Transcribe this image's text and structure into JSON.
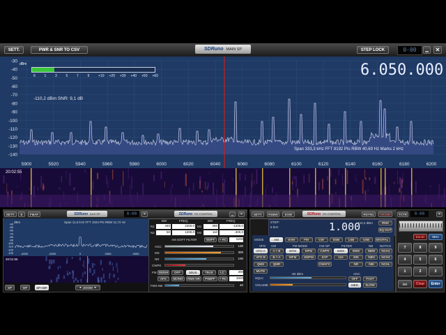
{
  "main": {
    "sett_label": "SETT.",
    "pwr_snr_label": "PWR & SNR TO CSV",
    "logo": "SDRuno",
    "window_title": "MAIN SP",
    "step_lock_label": "STEP LOCK",
    "dbm_unit": "dBm",
    "smeter_ticks": [
      "6",
      "1",
      "3",
      "5",
      "7",
      "9",
      "+10",
      "+20",
      "+30",
      "+40",
      "+50",
      "+60"
    ],
    "signal_readout": "-110,2 dBm   SNR: 9,1 dB",
    "frequency": "6.050.000",
    "status_readout": "Span 333,3 kHz   FFT 8192 Pts   RBW 40,69 Hz   Marks 2 kHz",
    "waterfall_time": "20:02:55",
    "y_ticks": [
      "-30",
      "-40",
      "-50",
      "-60",
      "-70",
      "-80",
      "-90",
      "-100",
      "-110",
      "-120",
      "-130",
      "-140"
    ],
    "x_ticks": [
      "5900",
      "5920",
      "5940",
      "5960",
      "5980",
      "6000",
      "6020",
      "6040",
      "6060",
      "6080",
      "6100",
      "6120",
      "6140",
      "6160",
      "6180",
      "6200"
    ],
    "colors": {
      "spectrum_bg": "#1f3a64",
      "trace": "#c9cde6",
      "marker": "#c81e1e",
      "waterfall": "#1a0d3c"
    }
  },
  "aux": {
    "sett_label": "SETT.",
    "e_label": "E",
    "fmaf_label": "FMAF",
    "logo": "SDRuno",
    "window_title": "AUX SP",
    "dbm_unit": "dBm",
    "status_readout": "Span 11,5 kHz   FFT 1024 Pts   RBW 11,72 Hz",
    "y_ticks": [
      "-40",
      "-50",
      "-60",
      "-70",
      "-80",
      "-90",
      "-100",
      "-110",
      "-120",
      "-130"
    ],
    "x_ticks": [
      "-4000",
      "-2000",
      "0",
      "2000",
      "4000"
    ],
    "waterfall_time": "20:01:55",
    "sp_label": "SP",
    "wf_label": "WF",
    "spwf_label": "SP+WF",
    "zoom_label": "ZOOM"
  },
  "rx_control": {
    "logo": "SDRuno",
    "window_title": "RX CONTROL",
    "col_bw": "BW",
    "col_freq": "FREQ",
    "n1_label": "N1",
    "n1_bw": "440",
    "n1_freq": "2200,0",
    "m1_label": "M1",
    "m1_bw": "260",
    "m1_freq": "-1200,0",
    "n2_label": "N2",
    "n2_bw": "50",
    "n2_freq": "1200,0",
    "m2_label": "M2",
    "m2_bw": "110",
    "m2_freq": "-300,0",
    "am_soft_filter_label": "AM SOFT FILTER",
    "soft_label": "SOFT",
    "plus_rc_label": "+ RC",
    "rc_value": "5200",
    "agc_label": "AGC",
    "agc_value": "130",
    "ms_label": "MS",
    "ms_value": "300",
    "nr_label": "NR",
    "nr_value": "100",
    "cwpk_label": "CWPK",
    "fm_label": "FM",
    "deem_label": "DEEM",
    "off_label": "OFF",
    "deem_50": "50US",
    "deem_75": "75US",
    "lc_label": "LC",
    "lc_value": "300",
    "afc_label": "AFC",
    "mono_label": "MONO",
    "rms_nr_label": "RMS NR",
    "psbpf_label": "PSBPF",
    "plus_rc2_label": "+ RC",
    "rc2_value": "3000",
    "fmsnb_label": "FMS-NB",
    "fmsnb_value": "40"
  },
  "rx": {
    "sett_label": "SETT.",
    "rsbw_label": "RSBW",
    "exw_label": "EXW",
    "logo": "SDRuno",
    "window_title": "RX CONTROL",
    "rsyn_label": "RSYN1",
    "mcmb_label": "MCMB",
    "step_label": "STEP:",
    "step_value": "5 kHz",
    "frequency": "1.000",
    "dbm_value": "-110,2 dBm",
    "rms_label": "RMS",
    "sq_out_label": "SQ OUT",
    "mode_label": "MODE",
    "modes": [
      "AM",
      "SAM",
      "FM",
      "CW",
      "DSB",
      "LSB",
      "USB",
      "DIGITAL"
    ],
    "vfo_label": "VFO",
    "cm_label": "CM",
    "vfo_a": "VFO A",
    "a_b": "A > B",
    "vfo_b": "VFO B",
    "b_a": "B > A",
    "qms": "QMS",
    "qmr": "QMR",
    "mute": "MUTE",
    "fm_mode_label": "FM MODE",
    "nfm": "NFM",
    "mfm": "MFM",
    "wfm": "WFM",
    "swfm": "SWFM",
    "cw_op_label": "CW OP",
    "cwpk": "CWPK",
    "zap": "ZAP",
    "cwafc": "CWAFC",
    "filter_label": "FILTER",
    "f6000": "6000",
    "f8000": "8000",
    "f11k": "11K",
    "f20k": "20K",
    "nr": "NR",
    "nb": "NB",
    "nb_label": "NB",
    "notch_label": "NOTCH",
    "nbw": "NBW",
    "nch1": "NCH1",
    "nbn": "NBN",
    "nch2": "NCH2",
    "nbi": "NBI",
    "nchl": "NCHL",
    "sqlc_label": "SQLC",
    "sqlc_value": "-84 dBm",
    "agc_label": "AGC",
    "agc_off": "OFF",
    "agc_fast": "FAST",
    "volume_label": "VOLUME",
    "agc_med": "MED",
    "agc_slow": "SLOW"
  },
  "tctr": {
    "label": "TCTR",
    "bands_label": "Bands",
    "mem_label": "MHz",
    "keys": [
      "7",
      "8",
      "9",
      "4",
      "5",
      "6",
      "1",
      "2",
      "3",
      "0",
      "."
    ],
    "kw_label": "kW",
    "clear_label": "Clear",
    "enter_label": "Enter"
  }
}
